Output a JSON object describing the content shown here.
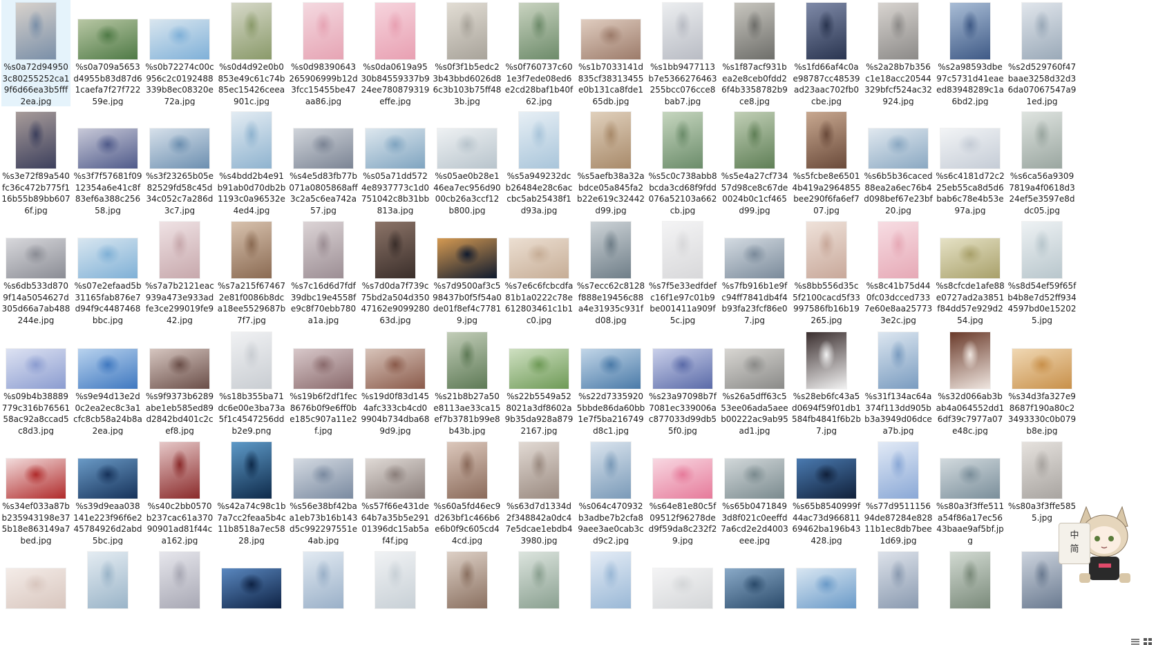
{
  "window": {
    "type": "file-explorer-large-icons"
  },
  "ime": {
    "lang_label": "中",
    "mode_label": "简"
  },
  "mascot": {
    "icon": "cat-girl-mascot-icon"
  },
  "view_toggle": {
    "icons": [
      "details-view-icon",
      "large-icons-view-icon"
    ]
  },
  "files": [
    {
      "name": "%s0a72d949503c80255252ca19f6d66ea3b5fff2ea.jpg",
      "selected": true,
      "orient": "p",
      "c": [
        "#7a8fa8",
        "#d8d2cc"
      ]
    },
    {
      "name": "%s0a709a5653d4955b83d87d61caefa7f27f72259e.jpg",
      "orient": "l",
      "c": [
        "#4f7a46",
        "#b8c7a4"
      ]
    },
    {
      "name": "%s0b72274c00c956c2c0192488339b8ec08320e72a.jpg",
      "orient": "l",
      "c": [
        "#7fb0d8",
        "#d9e6ef"
      ]
    },
    {
      "name": "%s0d4d92e0b0853e49c61c74b85ec15426ceea901c.jpg",
      "orient": "p",
      "c": [
        "#8a9a6a",
        "#d6d8c8"
      ]
    },
    {
      "name": "%s0d98390643265906999b12d3fcc15455be47aa86.jpg",
      "orient": "p",
      "c": [
        "#e6a4b4",
        "#f4d9e0"
      ]
    },
    {
      "name": "%s0da0619a9530b84559337b924ee780879319effe.jpg",
      "orient": "p",
      "c": [
        "#e8a0b2",
        "#f6d4dd"
      ]
    },
    {
      "name": "%s0f3f1b5edc23b43bbd6026d86c3b103b75ff483b.jpg",
      "orient": "p",
      "c": [
        "#a8a39a",
        "#e2ddd4"
      ]
    },
    {
      "name": "%s0f760737c601e3f7ede08ed6e2cd28baf1b40f62.jpg",
      "orient": "p",
      "c": [
        "#6d8b6a",
        "#c9d3c0"
      ]
    },
    {
      "name": "%s1b7033141d835cf38313455e0b131ca8fde165db.jpg",
      "orient": "l",
      "c": [
        "#9c7b6a",
        "#e0cdc0"
      ]
    },
    {
      "name": "%s1bb9477113b7e5366276463255bcc076cce8bab7.jpg",
      "orient": "p",
      "c": [
        "#b9bcc4",
        "#eceef0"
      ]
    },
    {
      "name": "%s1f87acf931bea2e8ceb0fdd26f4b3358782b9ce8.jpg",
      "orient": "p",
      "c": [
        "#6e6e6a",
        "#c8c6bf"
      ]
    },
    {
      "name": "%s1fd66af4c0ae98787cc48539ad23aac702fb0cbe.jpg",
      "orient": "p",
      "c": [
        "#2a3550",
        "#7f8aa8"
      ]
    },
    {
      "name": "%s2a28b7b356c1e18acc20544329bfcf524ac32924.jpg",
      "orient": "p",
      "c": [
        "#8c8a88",
        "#d8d4d0"
      ]
    },
    {
      "name": "%s2a98593dbe97c5731d41eaeed83948289c1a6bd2.jpg",
      "orient": "p",
      "c": [
        "#3f5a86",
        "#a9bdd6"
      ]
    },
    {
      "name": "%s2d529760f47baae3258d32d36da07067547a91ed.jpg",
      "orient": "p",
      "c": [
        "#9aa9b8",
        "#e1e6ec"
      ]
    },
    {
      "name": "%s3e72f89a540fc36c472b775f116b55b89bb6076f.jpg",
      "orient": "p",
      "c": [
        "#3c3f5c",
        "#a89c9a"
      ]
    },
    {
      "name": "%s3f7f57681f0912354a6e41c8f83ef6a388c25658.jpg",
      "orient": "l",
      "c": [
        "#4f5a8a",
        "#c8c9d8"
      ]
    },
    {
      "name": "%s3f23265b05e82529fd58c45d34c052c7a286d3c7.jpg",
      "orient": "l",
      "c": [
        "#6c8fb0",
        "#d6e0ea"
      ]
    },
    {
      "name": "%s4bdd2b4e91b91ab0d70db2b1193c0a96532e4ed4.jpg",
      "orient": "p",
      "c": [
        "#8fb3cf",
        "#e3ecf3"
      ]
    },
    {
      "name": "%s4e5d83fb77b071a0805868aff3c2a5c6ea742a57.jpg",
      "orient": "l",
      "c": [
        "#7b8494",
        "#d0d4da"
      ]
    },
    {
      "name": "%s05a71dd5724e8937773c1d0751042c8b31bb813a.jpg",
      "orient": "l",
      "c": [
        "#7fa4c0",
        "#dde7ee"
      ]
    },
    {
      "name": "%s05ae0b28e146ea7ec956d9000cb26a3ccf12b800.jpg",
      "orient": "l",
      "c": [
        "#b8c4cc",
        "#eef1f3"
      ]
    },
    {
      "name": "%s5a949232dcb26484e28c6accbc5ab25438f1d93a.jpg",
      "orient": "p",
      "c": [
        "#a9c5da",
        "#e7eff5"
      ]
    },
    {
      "name": "%s5aefb38a32abdce05a845fa2b22e619c32442d99.jpg",
      "orient": "p",
      "c": [
        "#a88a6a",
        "#e0d0bc"
      ]
    },
    {
      "name": "%s5c0c738abb8bcda3cd68f9fdd076a52103a662cb.jpg",
      "orient": "p",
      "c": [
        "#6b8c6a",
        "#c6d6bf"
      ]
    },
    {
      "name": "%s5e4a27cf73457d98ce8c67de0024b0c1cf465d99.jpg",
      "orient": "p",
      "c": [
        "#5f7f56",
        "#c1cfb6"
      ]
    },
    {
      "name": "%s5fcbe8e65014b419a2964855bee290f6fa6ef707.jpg",
      "orient": "p",
      "c": [
        "#6a4a3a",
        "#c8a890"
      ]
    },
    {
      "name": "%s6b5b36caced88ea2a6ec76b4d098bef67e23bf20.jpg",
      "orient": "l",
      "c": [
        "#8aa8c2",
        "#e0e8ef"
      ]
    },
    {
      "name": "%s6c4181d72c225eb55ca8d5d6bab6c78e4b53e97a.jpg",
      "orient": "l",
      "c": [
        "#c5ccd6",
        "#f2f4f6"
      ]
    },
    {
      "name": "%s6ca56a93097819a4f0618d324ef5e3597e8ddc05.jpg",
      "orient": "p",
      "c": [
        "#9aa6a0",
        "#dfe4e0"
      ]
    },
    {
      "name": "%s6db533d8709f14a5054627d305d66a7ab488244e.jpg",
      "orient": "l",
      "c": [
        "#8a8c94",
        "#d8d8dc"
      ]
    },
    {
      "name": "%s07e2efaad5b31165fab876e7d94f9c4487468bbc.jpg",
      "orient": "l",
      "c": [
        "#7fb0d6",
        "#d8e6f0"
      ]
    },
    {
      "name": "%s7a7b2121eac939a473e933adfe3ce299019fe942.jpg",
      "orient": "p",
      "c": [
        "#c7a8ac",
        "#efe2e4"
      ]
    },
    {
      "name": "%s7a215f674672e81f0086b8dca18ee5529687b7f7.jpg",
      "orient": "p",
      "c": [
        "#8a6a52",
        "#d8c2ae"
      ]
    },
    {
      "name": "%s7c16d6d7fdf39dbc19e4558fe9c8f70ebb780a1a.jpg",
      "orient": "p",
      "c": [
        "#9c8e94",
        "#dcd4d6"
      ]
    },
    {
      "name": "%s7d0da7f739c75bd2a504d35047162e909928063d.jpg",
      "orient": "p",
      "c": [
        "#3a2e2a",
        "#8c7468"
      ]
    },
    {
      "name": "%s7d9500af3c598437b0f5f54a0de01f8ef4c77819.jpg",
      "orient": "l",
      "c": [
        "#0f1a2e",
        "#d59a52"
      ]
    },
    {
      "name": "%s7e6c6fcbcdfa81b1a0222c78e612803461c1b1c0.jpg",
      "orient": "l",
      "c": [
        "#c6ad96",
        "#ecdfd2"
      ]
    },
    {
      "name": "%s7ecc62c8128f888e19456c88a4e31935c931fd08.jpg",
      "orient": "p",
      "c": [
        "#6f7e88",
        "#cdd3d7"
      ]
    },
    {
      "name": "%s7f5e33edfdefc16f1e97c01b9be001411a909f5c.jpg",
      "orient": "p",
      "c": [
        "#d8d8da",
        "#f4f4f5"
      ]
    },
    {
      "name": "%s7fb916b1e9fc94ff7841db4f4b93fa23fcf86e07.jpg",
      "orient": "l",
      "c": [
        "#7a8a9a",
        "#d4dbe2"
      ]
    },
    {
      "name": "%s8bb556d35c5f2100cacd5f33997586fb16b19265.jpg",
      "orient": "p",
      "c": [
        "#c8a89a",
        "#efe2da"
      ]
    },
    {
      "name": "%s8c41b75d440fc03dcced7337e60e8aa257733e2c.jpg",
      "orient": "p",
      "c": [
        "#e6a9b6",
        "#f7dde3"
      ]
    },
    {
      "name": "%s8cfcde1afe88e0727ad2a3851f84dd57e929d254.jpg",
      "orient": "l",
      "c": [
        "#a8a06a",
        "#e6e2c6"
      ]
    },
    {
      "name": "%s8d54ef59f65fb4b8e7d52ff9344597bd0e152025.jpg",
      "orient": "p",
      "c": [
        "#b8c6cc",
        "#eef2f4"
      ]
    },
    {
      "name": "%s09b4b38889779c316b7656158ac92a8ccad5c8d3.jpg",
      "orient": "l",
      "c": [
        "#8b9cd0",
        "#dde2f2"
      ]
    },
    {
      "name": "%s9e94d13e2d0c2ea2ec8c3a1cfc8cb58a24b8a2ea.jpg",
      "orient": "l",
      "c": [
        "#3f78c0",
        "#b8d2ee"
      ]
    },
    {
      "name": "%s9f9373b6289abe1eb585ed89d2842bd401c2cef8.jpg",
      "orient": "l",
      "c": [
        "#6a4e48",
        "#d6c6c0"
      ]
    },
    {
      "name": "%s18b355ba71dc6e00e3ba73a5f1c4547256ddb2e9.png",
      "orient": "p",
      "c": [
        "#c9cdd2",
        "#f0f1f3"
      ]
    },
    {
      "name": "%s19b6f2df1fec8676b0f9e6ff0be185c907a11e2f.jpg",
      "orient": "l",
      "c": [
        "#8a6a6c",
        "#d8c8ca"
      ]
    },
    {
      "name": "%s19d0f83d1454afc333cb4cd09904b734dba689d9.jpg",
      "orient": "l",
      "c": [
        "#8a5a4a",
        "#d8c4ba"
      ]
    },
    {
      "name": "%s21b8b27a50e8113ae33ca15ef7b3781b99e8b43b.jpg",
      "orient": "p",
      "c": [
        "#5e7a56",
        "#c2cdb8"
      ]
    },
    {
      "name": "%s22b5549a528021a3df8602a9b35da928a8792167.jpg",
      "orient": "l",
      "c": [
        "#6e9a56",
        "#cfe0c2"
      ]
    },
    {
      "name": "%s22d73359205bbde86da60bb1e7f5ba216749d8c1.jpg",
      "orient": "l",
      "c": [
        "#4a7aa8",
        "#c2d6e8"
      ]
    },
    {
      "name": "%s23a97098b7f7081ec339006ac877033d99db55f0.jpg",
      "orient": "l",
      "c": [
        "#5a6aa8",
        "#cad0ea"
      ]
    },
    {
      "name": "%s26a5dff63c553ee06ada5aeeb00222ac9ab95ad1.jpg",
      "orient": "l",
      "c": [
        "#8a8a88",
        "#d8d6d2"
      ]
    },
    {
      "name": "%s28eb6fc43a5d0694f59f01db1584fb4841f6b2b7.jpg",
      "orient": "p",
      "c": [
        "#f2f2f2",
        "#3a2e2e"
      ]
    },
    {
      "name": "%s31f134ac64a374f113dd905bb3a3949d06dcea7b.jpg",
      "orient": "p",
      "c": [
        "#7a9cc0",
        "#dce6f0"
      ]
    },
    {
      "name": "%s32d066ab3bab4a064552dd16df39c7977a07e48c.jpg",
      "orient": "p",
      "c": [
        "#efe6e0",
        "#6a3a2a"
      ]
    },
    {
      "name": "%s34d3fa327e98687f190a80c23493330c0b079b8e.jpg",
      "orient": "l",
      "c": [
        "#c8904a",
        "#f0d8b4"
      ]
    },
    {
      "name": "%s34ef033a87bb235943198e375b18e863149a7bed.jpg",
      "orient": "l",
      "c": [
        "#b02a2a",
        "#f2dcdc"
      ]
    },
    {
      "name": "%s39d9eaa038141e223f96f6e245784926d2abd5bc.jpg",
      "orient": "l",
      "c": [
        "#16325a",
        "#6a9ac6"
      ]
    },
    {
      "name": "%s40c2bb0570b237cac61a37090901ad81f44ca162.jpg",
      "orient": "p",
      "c": [
        "#8a2a2a",
        "#e6c8c8"
      ]
    },
    {
      "name": "%s42a74c98c1b7a7cc2feaa5b4c11b8518a7ec5828.jpg",
      "orient": "p",
      "c": [
        "#0e2a4a",
        "#5e9ac8"
      ]
    },
    {
      "name": "%s56e38bf42baa1eb73b16b143d5c992297551e4ab.jpg",
      "orient": "l",
      "c": [
        "#7a8aa0",
        "#d4dae2"
      ]
    },
    {
      "name": "%s57f66e431de64b7a35b5e29101396dc15ab5af4f.jpg",
      "orient": "l",
      "c": [
        "#8a7e7a",
        "#e0dad6"
      ]
    },
    {
      "name": "%s60a5fd46ec9d263bf1c466b6e6b0f9c605cd44cd.jpg",
      "orient": "p",
      "c": [
        "#8a6a5a",
        "#dcc8bc"
      ]
    },
    {
      "name": "%s63d7d1334d2f348842a0dc47e5dcae1ebdb43980.jpg",
      "orient": "p",
      "c": [
        "#9a8a80",
        "#e2dad4"
      ]
    },
    {
      "name": "%s064c470932b3adbe7b2cfa89aee3ae0cab3cd9c2.jpg",
      "orient": "p",
      "c": [
        "#7a9ab8",
        "#dae4ee"
      ]
    },
    {
      "name": "%s64e81e80c5f09512f96278ded9f59da8c232f29.jpg",
      "orient": "l",
      "c": [
        "#e67a9a",
        "#f8d8e2"
      ]
    },
    {
      "name": "%s65b04718493d8f021c0eeffd7a6cd2e2d4003eee.jpg",
      "orient": "l",
      "c": [
        "#7a8a8e",
        "#d2d8da"
      ]
    },
    {
      "name": "%s65b8540999f44ac73d96681169462ba196b43428.jpg",
      "orient": "l",
      "c": [
        "#10203a",
        "#4a7ab0"
      ]
    },
    {
      "name": "%s77d951115694de87284e82811b1ec8db7bee1d69.jpg",
      "orient": "p",
      "c": [
        "#8aa8d6",
        "#e2eaf6"
      ]
    },
    {
      "name": "%s80a3f3ffe511a54f86a17ec5643baae9af5bf.jpg",
      "orient": "l",
      "c": [
        "#7a8e9a",
        "#d2dade"
      ]
    },
    {
      "name": "%s80a3f3ffe5855.jpg",
      "orient": "p",
      "c": [
        "#a8a4a0",
        "#e6e2de"
      ]
    },
    {
      "orient": "l",
      "c": [
        "#d8c6be",
        "#f4ece8"
      ]
    },
    {
      "orient": "p",
      "c": [
        "#9ab4c8",
        "#e4ecf2"
      ]
    },
    {
      "orient": "p",
      "c": [
        "#a8a8b4",
        "#e6e6ec"
      ]
    },
    {
      "orient": "l",
      "c": [
        "#0e2244",
        "#5a88c0"
      ]
    },
    {
      "orient": "p",
      "c": [
        "#9ab0c8",
        "#e2eaf2"
      ]
    },
    {
      "orient": "p",
      "c": [
        "#c8d0d6",
        "#f0f2f4"
      ]
    },
    {
      "orient": "p",
      "c": [
        "#8a7060",
        "#ddd0c6"
      ]
    },
    {
      "orient": "p",
      "c": [
        "#8aa090",
        "#dce4de"
      ]
    },
    {
      "orient": "p",
      "c": [
        "#9ab8d6",
        "#e4ecf6"
      ]
    },
    {
      "orient": "l",
      "c": [
        "#d4d6d8",
        "#f4f4f5"
      ]
    },
    {
      "orient": "l",
      "c": [
        "#2a4a6a",
        "#8aaac8"
      ]
    },
    {
      "orient": "l",
      "c": [
        "#6a9ac8",
        "#d8e6f2"
      ]
    },
    {
      "orient": "p",
      "c": [
        "#8a9ab0",
        "#dde2ea"
      ]
    },
    {
      "orient": "p",
      "c": [
        "#7a8a7a",
        "#d2dad2"
      ]
    },
    {
      "orient": "p",
      "c": [
        "#6a7a90",
        "#cdd4de"
      ]
    }
  ]
}
